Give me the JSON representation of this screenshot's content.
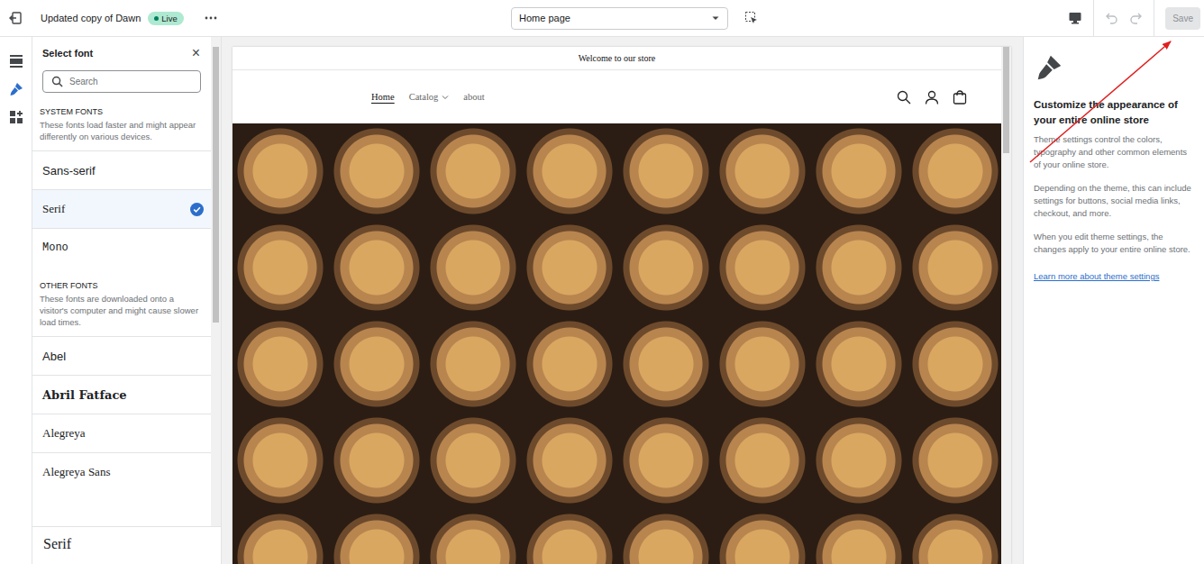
{
  "editor": {
    "theme_name": "Updated copy of Dawn",
    "status": "Live",
    "page_select": "Home page",
    "save": {
      "label": "Save",
      "disabled": true
    },
    "undo": {
      "disabled": true
    },
    "redo": {
      "disabled": true
    }
  },
  "rail": [
    {
      "kind": "sections",
      "selected": false
    },
    {
      "kind": "theme-settings",
      "selected": true
    },
    {
      "kind": "apps",
      "selected": false
    }
  ],
  "font_picker": {
    "title": "Select font",
    "close": "×",
    "search": {
      "placeholder": "Search"
    },
    "groups": [
      {
        "heading": "SYSTEM FONTS",
        "description": "These fonts load faster and might appear differently on various devices.",
        "fonts": [
          {
            "name": "Sans-serif",
            "kind": "sans",
            "selected": false
          },
          {
            "name": "Serif",
            "kind": "serif",
            "selected": true
          },
          {
            "name": "Mono",
            "kind": "mono",
            "selected": false
          }
        ]
      },
      {
        "heading": "OTHER FONTS",
        "description": "These fonts are downloaded onto a visitor's computer and might cause slower load times.",
        "fonts": [
          {
            "name": "Abel",
            "kind": "sans",
            "selected": false
          },
          {
            "name": "Abril Fatface",
            "kind": "display",
            "selected": false
          },
          {
            "name": "Alegreya",
            "kind": "serif",
            "selected": false
          },
          {
            "name": "Alegreya Sans",
            "kind": "serif",
            "selected": false
          }
        ]
      }
    ],
    "preview": "Serif"
  },
  "store_preview": {
    "announcement": "Welcome to our store",
    "nav": [
      {
        "label": "Home",
        "selected": true,
        "dropdown": false
      },
      {
        "label": "Catalog",
        "selected": false,
        "dropdown": true
      },
      {
        "label": "about",
        "selected": false,
        "dropdown": false
      }
    ]
  },
  "info_panel": {
    "heading": "Customize the appearance of your entire online store",
    "paragraphs": [
      "Theme settings control the colors, typography and other common elements of your online store.",
      "Depending on the theme, this can include settings for buttons, social media links, checkout, and more.",
      "When you edit theme settings, the changes apply to your entire online store."
    ],
    "link": "Learn more about theme settings"
  }
}
